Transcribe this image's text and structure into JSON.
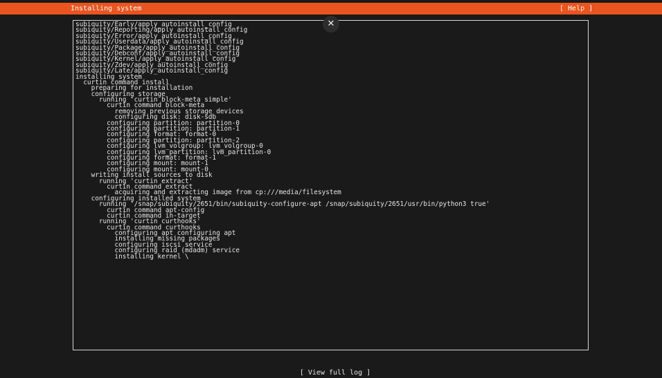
{
  "header": {
    "title": "Installing system",
    "help_label": "[ Help ]",
    "accent_color": "#e9541f"
  },
  "dialog": {
    "close_icon": "close-icon",
    "close_glyph": "✕"
  },
  "log": {
    "lines": [
      "subiquity/Early/apply_autoinstall_config",
      "subiquity/Reporting/apply_autoinstall_config",
      "subiquity/Error/apply_autoinstall_config",
      "subiquity/Userdata/apply_autoinstall_config",
      "subiquity/Package/apply_autoinstall_config",
      "subiquity/Debconf/apply_autoinstall_config",
      "subiquity/Kernel/apply_autoinstall_config",
      "subiquity/Zdev/apply_autoinstall_config",
      "subiquity/Late/apply_autoinstall_config",
      "installing system",
      "  curtin command install",
      "    preparing for installation",
      "    configuring storage",
      "      running 'curtin block-meta simple'",
      "        curtin command block-meta",
      "          removing previous storage devices",
      "          configuring disk: disk-sdb",
      "        configuring partition: partition-0",
      "        configuring partition: partition-1",
      "        configuring format: format-0",
      "        configuring partition: partition-2",
      "        configuring lvm_volgroup: lvm_volgroup-0",
      "        configuring lvm_partition: lvm_partition-0",
      "        configuring format: format-1",
      "        configuring mount: mount-1",
      "        configuring mount: mount-0",
      "    writing install sources to disk",
      "      running 'curtin extract'",
      "        curtin command extract",
      "          acquiring and extracting image from cp:///media/filesystem",
      "    configuring installed system",
      "      running '/snap/subiquity/2651/bin/subiquity-configure-apt /snap/subiquity/2651/usr/bin/python3 true'",
      "        curtin command apt-config",
      "        curtin command in-target",
      "      running 'curtin curthooks'",
      "        curtin command curthooks",
      "          configuring apt configuring apt",
      "          installing missing packages",
      "          configuring iscsi service",
      "          configuring raid (mdadm) service",
      "          installing kernel \\"
    ]
  },
  "footer": {
    "view_full_log_label": "[ View full log ]"
  }
}
